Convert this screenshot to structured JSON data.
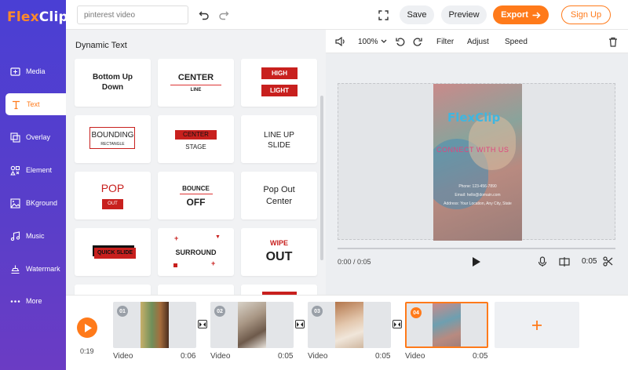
{
  "brand": {
    "logo_flex": "Flex",
    "logo_clip": "Clip",
    "accent": "#ff7a1a",
    "sidebar_color": "#4a3fd4"
  },
  "sidebar": {
    "items": [
      {
        "label": "Media",
        "icon": "media-icon"
      },
      {
        "label": "Text",
        "icon": "text-icon",
        "active": true
      },
      {
        "label": "Overlay",
        "icon": "overlay-icon"
      },
      {
        "label": "Element",
        "icon": "element-icon"
      },
      {
        "label": "BKground",
        "icon": "background-icon"
      },
      {
        "label": "Music",
        "icon": "music-icon"
      },
      {
        "label": "Watermark",
        "icon": "watermark-icon"
      },
      {
        "label": "More",
        "icon": "more-icon"
      }
    ]
  },
  "topbar": {
    "search_value": "pinterest video",
    "save_label": "Save",
    "preview_label": "Preview",
    "export_label": "Export",
    "signup_label": "Sign Up"
  },
  "panel": {
    "title": "Dynamic Text",
    "cards": [
      {
        "lines": [
          "Bottom Up",
          "Down"
        ]
      },
      {
        "lines": [
          "CENTER",
          "LINE"
        ]
      },
      {
        "lines": [
          "HIGH",
          "LIGHT"
        ]
      },
      {
        "lines": [
          "BOUNDING",
          "RECTANGLE"
        ]
      },
      {
        "lines": [
          "CENTER",
          "STAGE"
        ]
      },
      {
        "lines": [
          "LINE UP",
          "SLIDE"
        ]
      },
      {
        "lines": [
          "POP",
          "OUT"
        ]
      },
      {
        "lines": [
          "BOUNCE",
          "OFF"
        ]
      },
      {
        "lines": [
          "Pop Out",
          "Center"
        ]
      },
      {
        "lines": [
          "QUICK SLIDE"
        ]
      },
      {
        "lines": [
          "SURROUND"
        ]
      },
      {
        "lines": [
          "WIPE",
          "OUT"
        ]
      }
    ]
  },
  "editor": {
    "zoom": "100%",
    "filter_label": "Filter",
    "adjust_label": "Adjust",
    "speed_label": "Speed",
    "time_readout": "0:00 / 0:05",
    "duration": "0:05"
  },
  "preview": {
    "logo": "FlexClip",
    "tagline": "CONNECT WITH US",
    "phone": "Phone: 123-456-7890",
    "email": "Email: hello@domain.com",
    "address": "Address: Your Location, Any City, State"
  },
  "timeline": {
    "current_time": "0:19",
    "clips": [
      {
        "num": "01",
        "label": "Video",
        "duration": "0:06"
      },
      {
        "num": "02",
        "label": "Video",
        "duration": "0:05"
      },
      {
        "num": "03",
        "label": "Video",
        "duration": "0:05"
      },
      {
        "num": "04",
        "label": "Video",
        "duration": "0:05",
        "selected": true
      }
    ]
  }
}
